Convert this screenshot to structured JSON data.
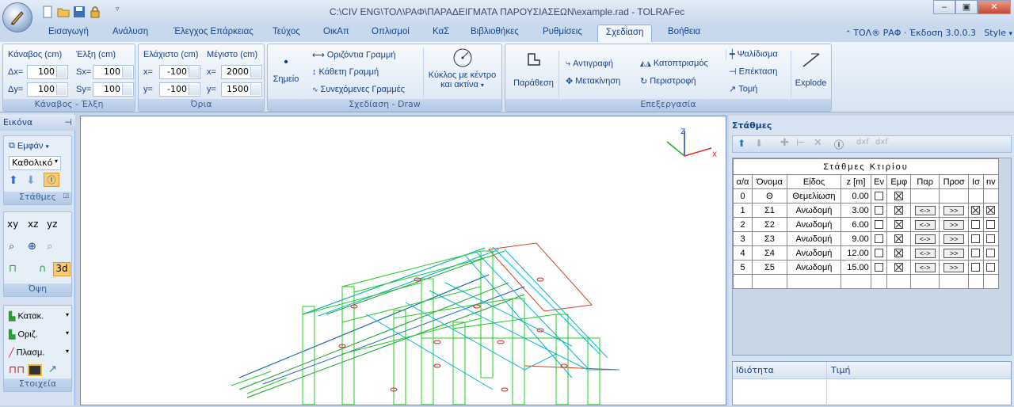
{
  "window": {
    "title": "C:\\CIV ENG\\ΤΟΛ\\ΡΑΦ\\ΠΑΡΑΔΕΙΓΜΑΤΑ ΠΑΡΟΥΣΙΑΣΕΩΝ\\example.rad - TOLRAFec"
  },
  "menu": {
    "tabs": [
      "Εισαγωγή",
      "Ανάλυση",
      "Έλεγχος Επάρκειας",
      "Τεύχος",
      "ΟικΑπ",
      "Οπλισμοί",
      "ΚαΣ",
      "Βιβλιοθήκες",
      "Ρυθμίσεις",
      "Σχεδίαση",
      "Βοήθεια"
    ],
    "active": "Σχεδίαση",
    "version": "ΤΟΛ® ΡΑΦ · Έκδοση 3.0.0.3",
    "style": "Style"
  },
  "ribbon": {
    "grid_group": {
      "kanavos_label": "Κάναβος (cm)",
      "elxi_label": "Έλξη (cm)",
      "dx_label": "Δx=",
      "dy_label": "Δy=",
      "sx_label": "Sx=",
      "sy_label": "Sy=",
      "dx": "100",
      "dy": "100",
      "sx": "100",
      "sy": "100",
      "caption": "Κάναβος - Έλξη"
    },
    "limits_group": {
      "min_label": "Ελάχιστο (cm)",
      "max_label": "Μέγιστο (cm)",
      "x_label": "x=",
      "y_label": "y=",
      "min_x": "-100",
      "min_y": "-100",
      "max_x": "2000",
      "max_y": "1500",
      "caption": "Όρια"
    },
    "draw_group": {
      "point": "Σημείο",
      "horizontal": "Οριζόντια Γραμμή",
      "vertical": "Κάθετη Γραμμή",
      "connected": "Συνεχόμενες Γραμμές",
      "circle_line1": "Κύκλος με κέντρο",
      "circle_line2": "και ακτίνα",
      "caption": "Σχεδίαση - Draw"
    },
    "edit_group": {
      "parathesi": "Παράθεση",
      "copy": "Αντιγραφή",
      "move": "Μετακίνηση",
      "mirror": "Κατοπτρισμός",
      "rotate": "Περιστροφή",
      "trim": "Ψαλίδισμα",
      "extend": "Επέκταση",
      "cut": "Τομή",
      "explode": "Explode",
      "caption": "Επεξεργασία"
    }
  },
  "left_panel": {
    "title": "Εικόνα",
    "show": "Εμφάν",
    "mode": "Καθολικό",
    "levels_caption": "Στάθμες",
    "view_xy": "xy",
    "view_xz": "xz",
    "view_yz": "yz",
    "view_3d": "3d",
    "view_caption": "Όψη",
    "katak": "Κατακ.",
    "oriz": "Οριζ.",
    "plasm": "Πλασμ.",
    "elements_caption": "Στοιχεία"
  },
  "canvas": {
    "axis_z": "Z",
    "axis_x": "X"
  },
  "levels_panel": {
    "title": "Στάθμες",
    "table_title": "Στάθμες Κτιρίου",
    "headers": [
      "α/α",
      "Όνομα",
      "Είδος",
      "z [m]",
      "Εν",
      "Εμφ",
      "Παρ",
      "Προσ",
      "Ισ",
      "nv"
    ],
    "rows": [
      {
        "n": "0",
        "name": "Θ",
        "kind": "Θεμελίωση",
        "z": "0.00",
        "en": false,
        "emf": true,
        "btns": false,
        "is": null,
        "nv": null
      },
      {
        "n": "1",
        "name": "Σ1",
        "kind": "Ανωδομή",
        "z": "3.00",
        "en": false,
        "emf": true,
        "btns": true,
        "is": true,
        "nv": true
      },
      {
        "n": "2",
        "name": "Σ2",
        "kind": "Ανωδομή",
        "z": "6.00",
        "en": false,
        "emf": true,
        "btns": true,
        "is": false,
        "nv": false
      },
      {
        "n": "3",
        "name": "Σ3",
        "kind": "Ανωδομή",
        "z": "9.00",
        "en": false,
        "emf": true,
        "btns": true,
        "is": false,
        "nv": false
      },
      {
        "n": "4",
        "name": "Σ4",
        "kind": "Ανωδομή",
        "z": "12.00",
        "en": false,
        "emf": true,
        "btns": true,
        "is": false,
        "nv": false
      },
      {
        "n": "5",
        "name": "Σ5",
        "kind": "Ανωδομή",
        "z": "15.00",
        "en": false,
        "emf": true,
        "btns": true,
        "is": false,
        "nv": false
      }
    ],
    "btn_par": "<->",
    "btn_pros": ">>"
  },
  "properties": {
    "col1": "Ιδιότητα",
    "col2": "Τιμή"
  }
}
